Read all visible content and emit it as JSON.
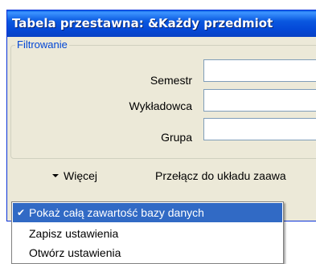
{
  "window": {
    "title": "Tabela przestawna: &Każdy przedmiot"
  },
  "filter_group": {
    "legend": "Filtrowanie",
    "fields": [
      {
        "label": "Semestr",
        "value": ""
      },
      {
        "label": "Wykładowca",
        "value": ""
      },
      {
        "label": "Grupa",
        "value": ""
      }
    ]
  },
  "actions": {
    "more_label": "Więcej",
    "switch_label": "Przełącz do układu zaawa"
  },
  "menu": {
    "items": [
      {
        "label": "Pokaż całą zawartość bazy danych",
        "checked": true,
        "selected": true
      },
      {
        "label": "Zapisz ustawienia",
        "checked": false,
        "selected": false
      },
      {
        "label": "Otwórz ustawienia",
        "checked": false,
        "selected": false
      }
    ]
  },
  "colors": {
    "titlebar": "#0a58e0",
    "dialog_bg": "#ece9d8",
    "legend_text": "#0046d5",
    "menu_highlight": "#316ac5"
  },
  "icons": {
    "more_arrow": "triangle-down-icon",
    "checkmark": "checkmark-icon"
  }
}
